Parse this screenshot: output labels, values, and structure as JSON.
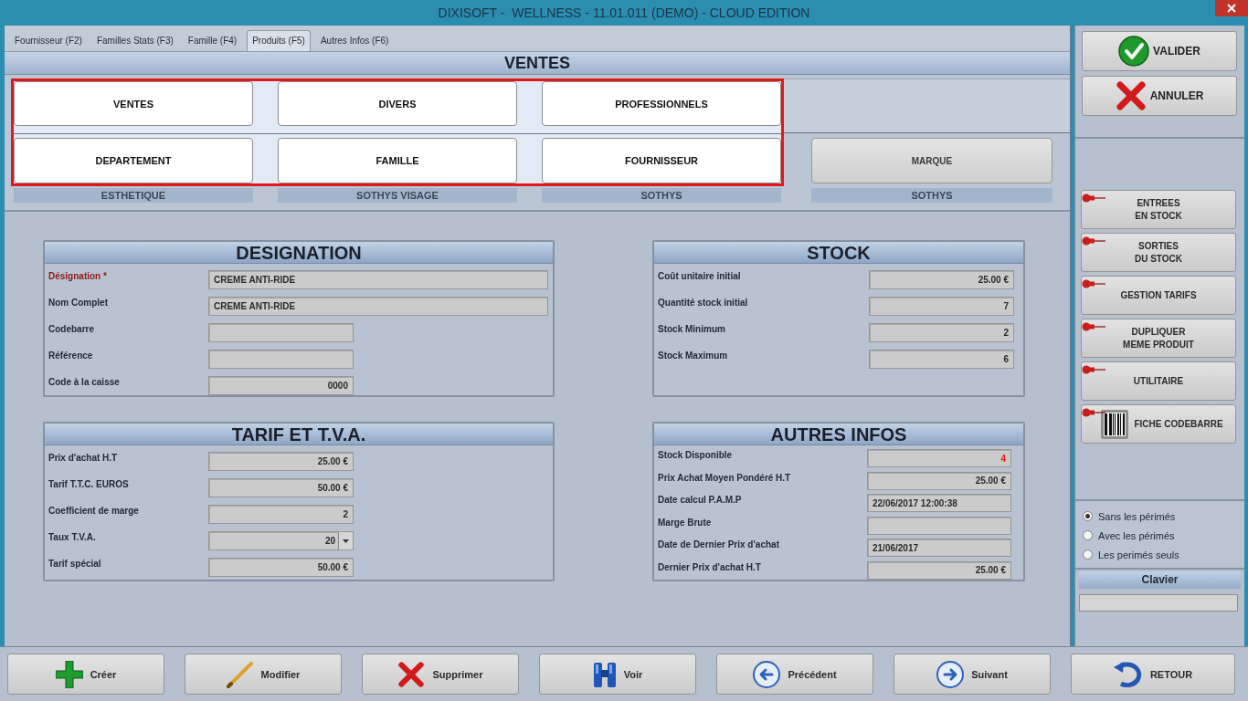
{
  "window": {
    "title": "DIXISOFT -  WELLNESS - 11.01.011 (DEMO) - CLOUD EDITION"
  },
  "tabs": [
    {
      "label": "Fournisseur (F2)",
      "selected": false
    },
    {
      "label": "Familles Stats (F3)",
      "selected": false
    },
    {
      "label": "Famille (F4)",
      "selected": false
    },
    {
      "label": "Produits (F5)",
      "selected": true
    },
    {
      "label": "Autres Infos (F6)",
      "selected": false
    }
  ],
  "ventes": {
    "title": "VENTES",
    "highlighted": true,
    "options": [
      "VENTES",
      "DIVERS",
      "PROFESSIONNELS",
      "DEPARTEMENT",
      "FAMILLE",
      "FOURNISSEUR"
    ],
    "marque_button": "MARQUE",
    "values": [
      "ESTHETIQUE",
      "SOTHYS VISAGE",
      "SOTHYS",
      "SOTHYS"
    ]
  },
  "designation": {
    "title": "DESIGNATION",
    "rows": [
      {
        "label": "Désignation *",
        "value": "CREME ANTI-RIDE",
        "kind": "text",
        "required": true
      },
      {
        "label": "Nom Complet",
        "value": "CREME ANTI-RIDE",
        "kind": "text",
        "required": false
      },
      {
        "label": "Codebarre",
        "kind": "text",
        "required": false
      },
      {
        "label": "Référence",
        "kind": "text",
        "required": false
      },
      {
        "label": "Code à la caisse",
        "value": "0000",
        "kind": "number",
        "required": false
      }
    ]
  },
  "tarif": {
    "title": "TARIF ET T.V.A.",
    "rows": [
      {
        "label": "Prix d'achat H.T",
        "value": "25.00 €",
        "kind": "number"
      },
      {
        "label": "Tarif T.T.C. EUROS",
        "value": "50.00 €",
        "kind": "number"
      },
      {
        "label": "Coefficient de marge",
        "value": "2",
        "kind": "number"
      },
      {
        "label": "Taux T.V.A.",
        "value": "20",
        "kind": "select"
      },
      {
        "label": "Tarif spécial",
        "value": "50.00 €",
        "kind": "number"
      }
    ]
  },
  "stock": {
    "title": "STOCK",
    "rows": [
      {
        "label": "Coût unitaire initial",
        "value": "25.00 €",
        "kind": "number"
      },
      {
        "label": "Quantité stock initial",
        "value": "7",
        "kind": "number"
      },
      {
        "label": "Stock Minimum",
        "value": "2",
        "kind": "number"
      },
      {
        "label": "Stock Maximum",
        "value": "6",
        "kind": "number"
      }
    ]
  },
  "autres_infos": {
    "title": "AUTRES INFOS",
    "rows": [
      {
        "label": "Stock Disponible",
        "value": "4",
        "kind": "number",
        "alert": true
      },
      {
        "label": "Prix Achat Moyen Pondéré H.T",
        "value": "25.00 €",
        "kind": "number",
        "alert": false
      },
      {
        "label": "Date calcul P.A.M.P",
        "value": "22/06/2017 12:00:38",
        "kind": "text",
        "alert": false
      },
      {
        "label": "Marge Brute",
        "kind": "text"
      },
      {
        "label": "Date de Dernier Prix d'achat",
        "value": "21/06/2017",
        "kind": "text",
        "alert": false
      },
      {
        "label": "Dernier Prix d'achat H.T",
        "value": "25.00 €",
        "kind": "number",
        "alert": false
      }
    ]
  },
  "sidebar": {
    "confirm_buttons": [
      {
        "label": "VALIDER",
        "kind": "confirm"
      },
      {
        "label": "ANNULER",
        "kind": "cancel"
      }
    ],
    "actions": [
      {
        "label": "ENTREES\nEN STOCK",
        "kind": "plain"
      },
      {
        "label": "SORTIES\nDU STOCK",
        "kind": "plain"
      },
      {
        "label": "GESTION TARIFS",
        "kind": "plain"
      },
      {
        "label": "DUPLIQUER\nMEME PRODUIT",
        "kind": "plain"
      },
      {
        "label": "UTILITAIRE",
        "kind": "plain"
      },
      {
        "label": "FICHE CODEBARRE",
        "kind": "barcode"
      }
    ],
    "expiry_filter": [
      {
        "label": "Sans les périmés",
        "selected": true
      },
      {
        "label": "Avec les périmés",
        "selected": false
      },
      {
        "label": "Les perimés seuls",
        "selected": false
      }
    ],
    "keyboard": {
      "title": "Clavier"
    }
  },
  "toolbar": [
    {
      "label": "Créer",
      "kind": "create"
    },
    {
      "label": "Modifier",
      "kind": "edit"
    },
    {
      "label": "Supprimer",
      "kind": "delete"
    },
    {
      "label": "Voir",
      "kind": "view"
    },
    {
      "label": "Précédent",
      "kind": "previous"
    },
    {
      "label": "Suivant",
      "kind": "next"
    },
    {
      "label": "RETOUR",
      "kind": "back"
    }
  ]
}
